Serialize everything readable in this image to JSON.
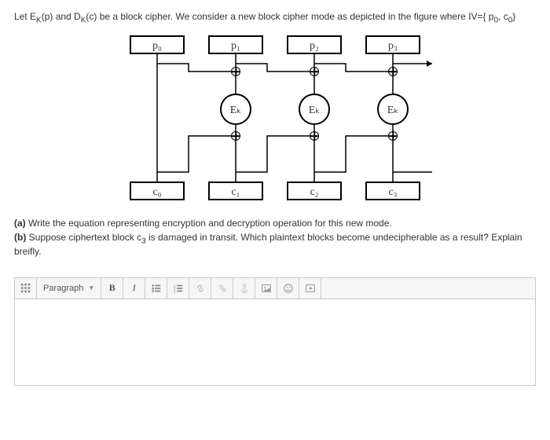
{
  "intro": {
    "pre": "Let E",
    "sub1": "K",
    "mid1": "(p) and D",
    "sub2": "K",
    "mid2": "(c) be a block cipher. We consider a new block cipher mode as depicted in the figure where  IV={ p",
    "sub3": "0",
    "mid3": ", c",
    "sub4": "0",
    "end": "}"
  },
  "diagram": {
    "p": [
      "p₀",
      "p₁",
      "p₂",
      "p₃"
    ],
    "c": [
      "c₀",
      "c₁",
      "c₂",
      "c₃"
    ],
    "e": "Eₖ"
  },
  "questions": {
    "a_label": "(a)",
    "a_text": " Write the equation representing encryption and decryption operation for this new mode.",
    "b_label": "(b)",
    "b_text_pre": " Suppose ciphertext block c",
    "b_sub": "3",
    "b_text_post": " is damaged in transit. Which plaintext blocks become undecipherable as a result? Explain breifly."
  },
  "toolbar": {
    "grid_icon": "grid-icon",
    "paragraph": "Paragraph",
    "bold": "B",
    "italic": "I",
    "ul": "bullet-list-icon",
    "ol": "numbered-list-icon",
    "link": "link-icon",
    "unlink": "unlink-icon",
    "anchor": "anchor-icon",
    "image": "image-icon",
    "emoji": "emoji-icon",
    "embed": "embed-icon"
  }
}
